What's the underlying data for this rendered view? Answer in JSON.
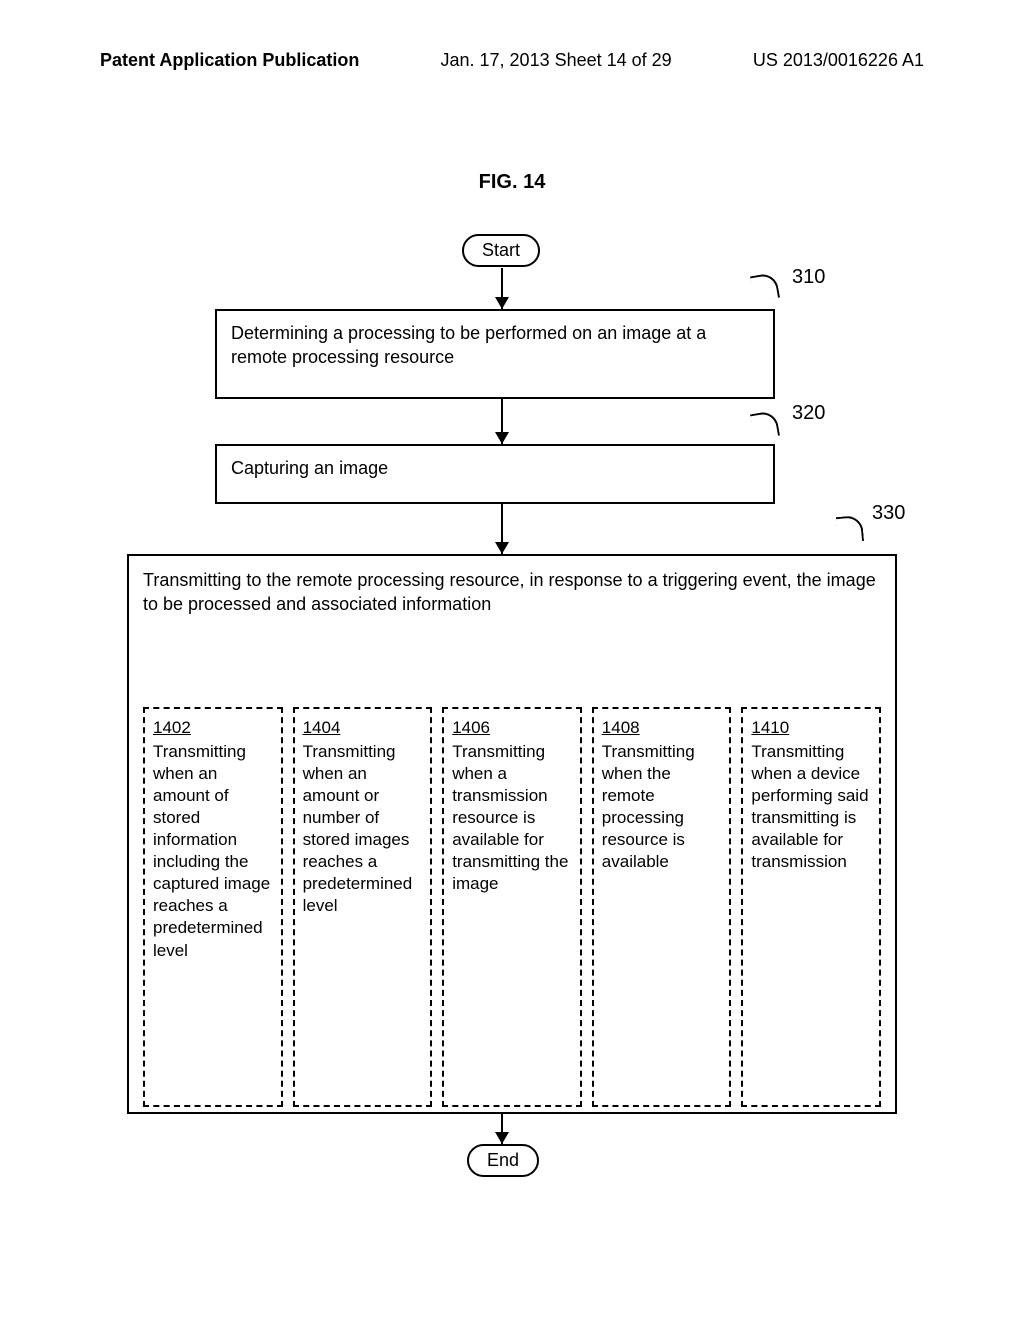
{
  "header": {
    "left": "Patent Application Publication",
    "center": "Jan. 17, 2013  Sheet 14 of 29",
    "right": "US 2013/0016226 A1"
  },
  "figure_label": "FIG. 14",
  "start": "Start",
  "end": "End",
  "boxes": {
    "b310": {
      "ref": "310",
      "text": "Determining a processing to be performed on an image at a remote processing resource"
    },
    "b320": {
      "ref": "320",
      "text": "Capturing an image"
    },
    "b330": {
      "ref": "330",
      "text": "Transmitting to the remote processing resource, in response to a triggering event, the image to be processed and associated information"
    }
  },
  "subboxes": [
    {
      "ref": "1402",
      "text": "Transmitting when an amount of stored information including the captured image reaches a predetermined level"
    },
    {
      "ref": "1404",
      "text": "Transmitting when an amount or number of stored images reaches a predetermined level"
    },
    {
      "ref": "1406",
      "text": "Transmitting when  a transmission resource is available for transmitting the image"
    },
    {
      "ref": "1408",
      "text": "Transmitting when the remote processing resource is available"
    },
    {
      "ref": "1410",
      "text": "Transmitting when a device performing said transmitting is available for transmission"
    }
  ]
}
